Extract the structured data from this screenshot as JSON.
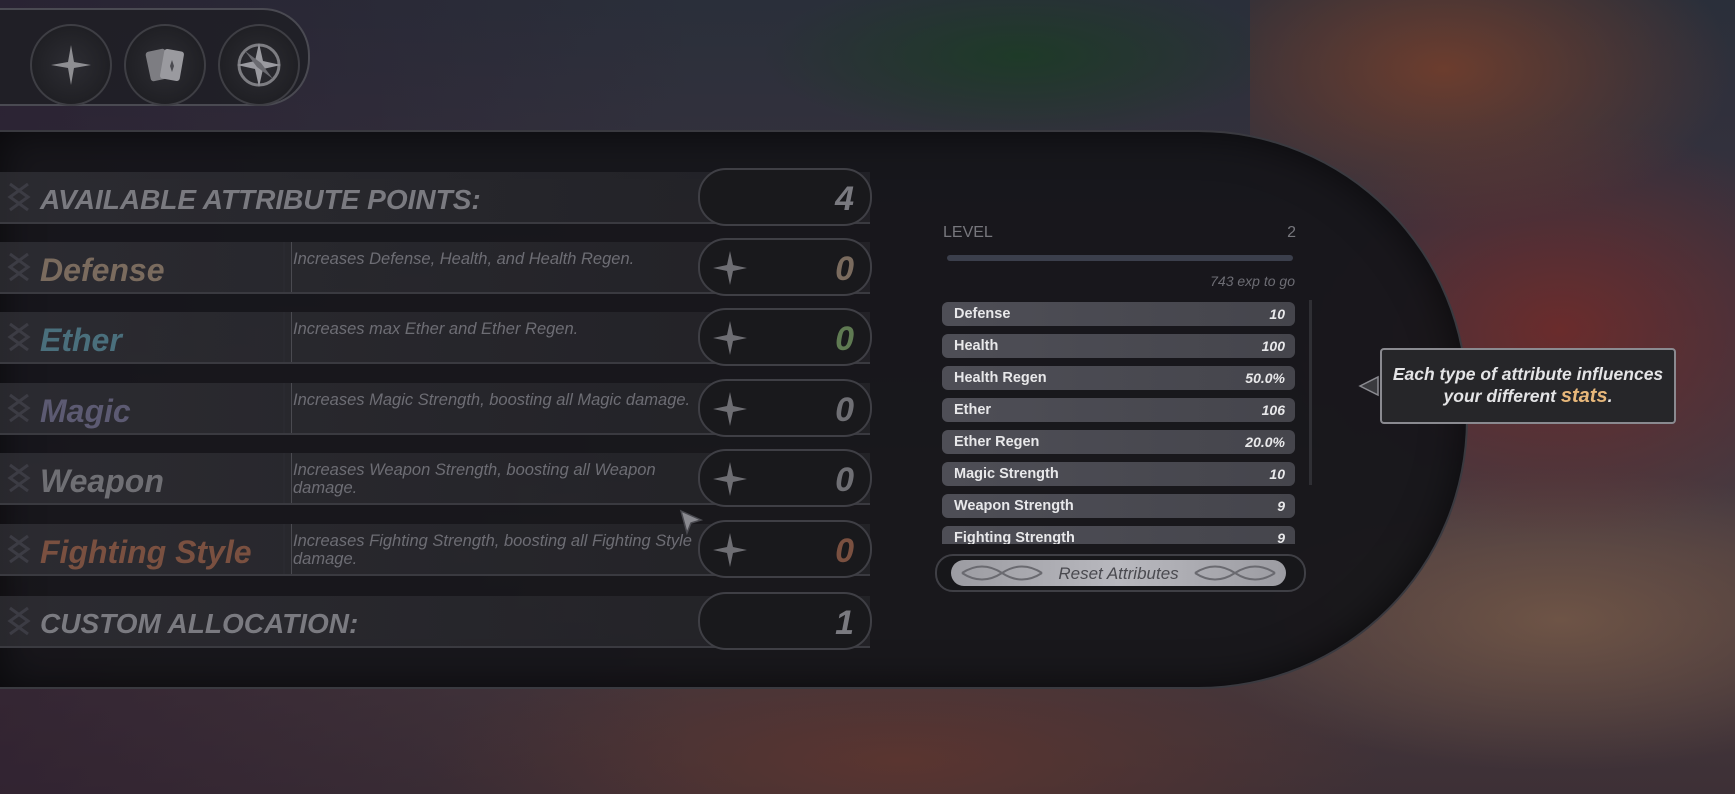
{
  "toolbar": {
    "icons": [
      "plus-icon",
      "cards-icon",
      "compass-icon"
    ]
  },
  "attributes_panel": {
    "available_label": "AVAILABLE ATTRIBUTE POINTS:",
    "available_value": "4",
    "rows": [
      {
        "name": "Defense",
        "desc": "Increases Defense, Health, and Health Regen.",
        "value": "0",
        "color": "#7a6b5e"
      },
      {
        "name": "Ether",
        "desc": "Increases max Ether and Ether Regen.",
        "value": "0",
        "color": "#4a6f7c"
      },
      {
        "name": "Magic",
        "desc": "Increases Magic Strength, boosting all Magic damage.",
        "value": "0",
        "color": "#5c5a72"
      },
      {
        "name": "Weapon",
        "desc": "Increases Weapon Strength, boosting all Weapon damage.",
        "value": "0",
        "color": "#6f6f74"
      },
      {
        "name": "Fighting Style",
        "desc": "Increases Fighting Strength, boosting all Fighting Style damage.",
        "value": "0",
        "color": "#7a5040"
      }
    ],
    "value_colors": [
      "#7a6b5e",
      "#5f7a52",
      "#6f6f74",
      "#6f6f74",
      "#7a5040"
    ],
    "custom_label": "CUSTOM ALLOCATION:",
    "custom_value": "1"
  },
  "stats_panel": {
    "level_label": "LEVEL",
    "level_value": "2",
    "level_progress": 0.0,
    "exp_text": "743 exp to go",
    "stats": [
      {
        "name": "Defense",
        "value": "10"
      },
      {
        "name": "Health",
        "value": "100"
      },
      {
        "name": "Health Regen",
        "value": "50.0%"
      },
      {
        "name": "Ether",
        "value": "106"
      },
      {
        "name": "Ether Regen",
        "value": "20.0%"
      },
      {
        "name": "Magic Strength",
        "value": "10"
      },
      {
        "name": "Weapon Strength",
        "value": "9"
      },
      {
        "name": "Fighting Strength",
        "value": "9"
      }
    ],
    "reset_label": "Reset Attributes"
  },
  "tooltip": {
    "text_before": "Each type of attribute influences your different ",
    "highlight": "stats",
    "text_after": "."
  }
}
